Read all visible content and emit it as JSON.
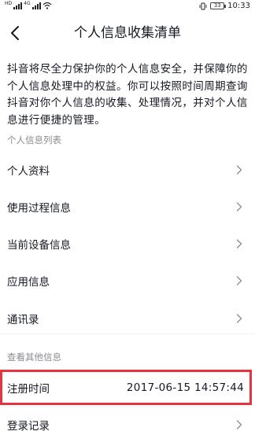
{
  "status_bar": {
    "carrier_tag": "HD",
    "network_tag": "4G",
    "battery": "33",
    "time": "10:33"
  },
  "header": {
    "title": "个人信息收集清单"
  },
  "intro_text": "抖音将尽全力保护你的个人信息安全，并保障你的个人信息处理中的权益。你可以按照时间周期查询抖音对你个人信息的收集、处理情况，并对个人信息进行便捷的管理。",
  "personal_section": {
    "label": "个人信息列表",
    "items": [
      {
        "label": "个人资料"
      },
      {
        "label": "使用过程信息"
      },
      {
        "label": "当前设备信息"
      },
      {
        "label": "应用信息"
      },
      {
        "label": "通讯录"
      }
    ]
  },
  "other_section": {
    "label": "查看其他信息",
    "register": {
      "label": "注册时间",
      "value": "2017-06-15 14:57:44"
    },
    "login": {
      "label": "登录记录"
    }
  },
  "colors": {
    "text": "#161823",
    "secondary": "#8a8b91",
    "highlight": "#e5343f"
  },
  "icons": [
    "back-arrow-icon",
    "chevron-right-icon",
    "signal-icon",
    "wifi-icon",
    "vibrate-icon",
    "battery-icon"
  ]
}
